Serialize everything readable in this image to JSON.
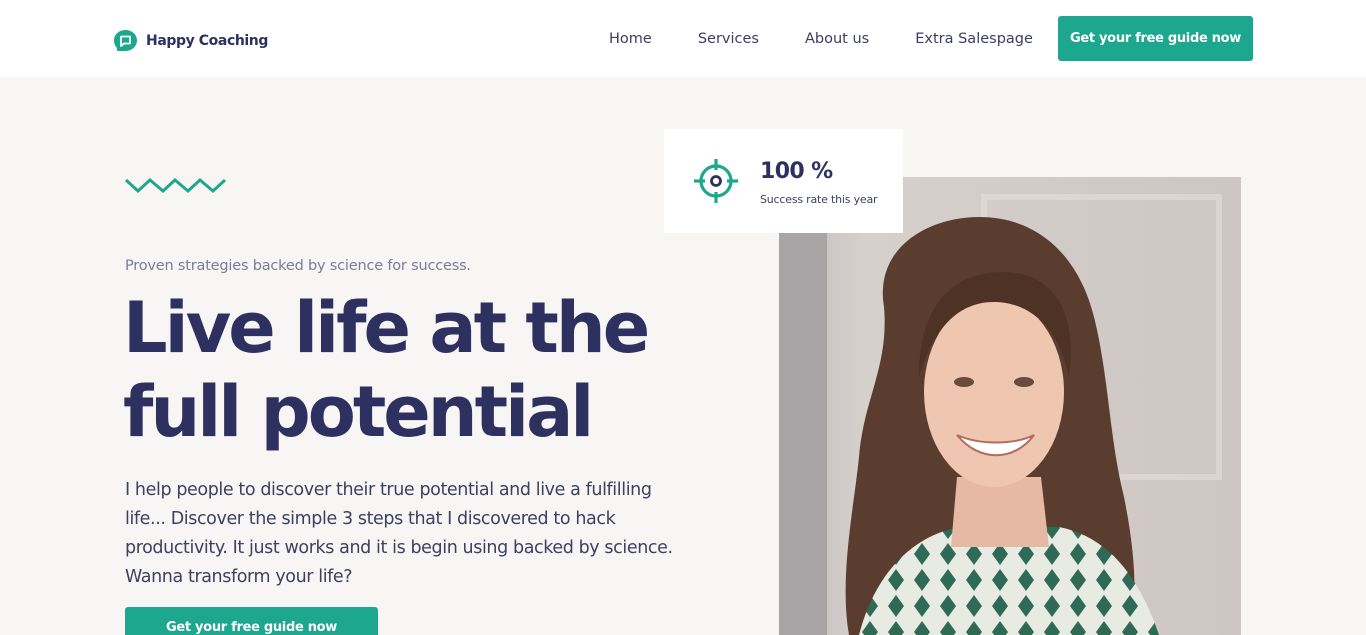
{
  "header": {
    "brand": "Happy Coaching",
    "nav": [
      {
        "label": "Home"
      },
      {
        "label": "Services"
      },
      {
        "label": "About us"
      },
      {
        "label": "Extra Salespage"
      }
    ],
    "cta_label": "Get your free guide now"
  },
  "hero": {
    "eyebrow": "Proven strategies backed by science for success.",
    "headline": "Live life at the full potential",
    "intro": "I help people to discover their true potential and live a fulfilling life... Discover the simple 3 steps that I discovered to hack productivity. It just works and it is begin using backed by science. Wanna transform your life?",
    "cta_label": "Get your free guide now"
  },
  "stat": {
    "value": "100 %",
    "label": "Success rate this year",
    "icon": "target-icon"
  },
  "colors": {
    "accent": "#1ea78f",
    "heading": "#2e3060",
    "background": "#f7f6f5"
  }
}
